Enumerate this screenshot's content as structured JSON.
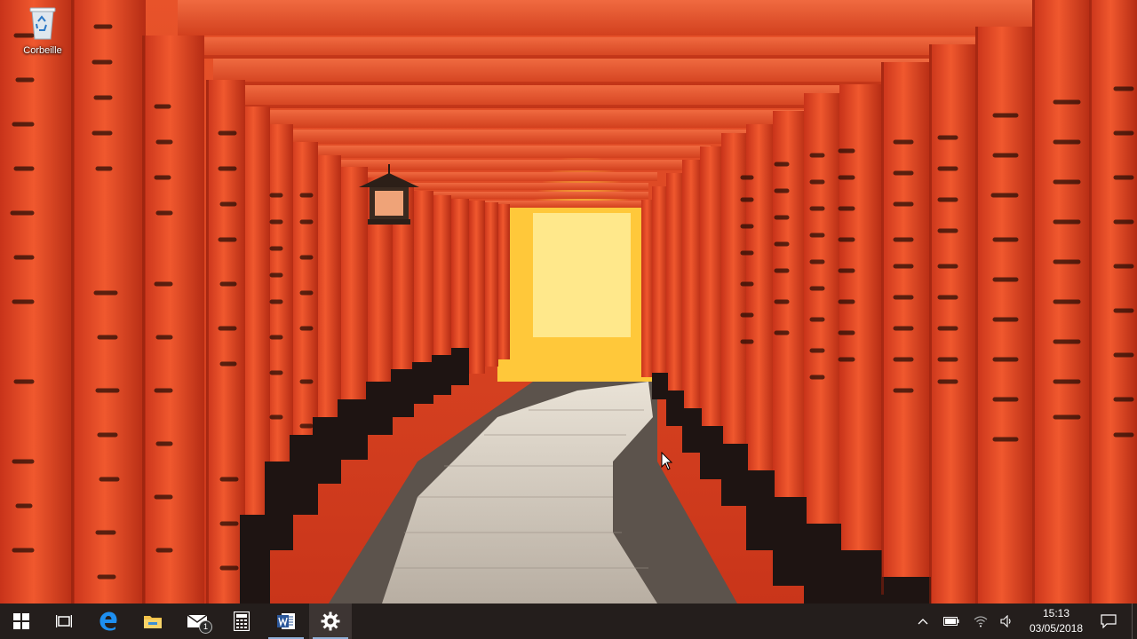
{
  "desktop": {
    "icons": [
      {
        "label": "Corbeille",
        "icon": "recycle-bin-icon"
      }
    ]
  },
  "taskbar": {
    "pinned": [
      {
        "name": "start",
        "icon": "windows-start-icon"
      },
      {
        "name": "task-view",
        "icon": "task-view-icon"
      },
      {
        "name": "edge",
        "icon": "edge-icon"
      },
      {
        "name": "file-explorer",
        "icon": "folder-icon"
      },
      {
        "name": "mail",
        "icon": "mail-icon",
        "badge": "1"
      },
      {
        "name": "calculator",
        "icon": "calculator-icon"
      },
      {
        "name": "word",
        "icon": "word-icon"
      },
      {
        "name": "settings",
        "icon": "gear-icon",
        "active": true
      }
    ],
    "tray": {
      "icons": [
        "chevron-up-icon",
        "battery-icon",
        "wifi-icon",
        "volume-icon"
      ],
      "time": "15:13",
      "date": "03/05/2018",
      "notifications_icon": "notification-icon"
    }
  },
  "colors": {
    "taskbar_bg": "#241e1c",
    "torii_red": "#e8482a",
    "accent": "#8fb0d8"
  }
}
